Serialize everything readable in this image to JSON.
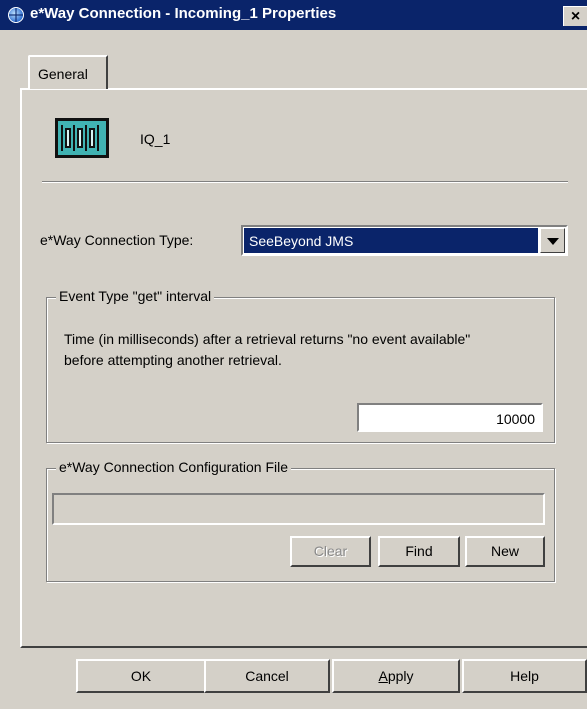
{
  "window": {
    "title": "e*Way Connection - Incoming_1 Properties",
    "close_glyph": "×",
    "icon": "globe-icon"
  },
  "tabs": [
    {
      "label": "General",
      "selected": true
    }
  ],
  "component": {
    "icon": "queue-component-icon",
    "name": "IQ_1"
  },
  "connection_type": {
    "label": "e*Way Connection Type:",
    "selected_value": "SeeBeyond JMS"
  },
  "interval_group": {
    "title": "Event Type \"get\" interval",
    "description": "Time (in milliseconds) after a retrieval returns \"no event available\" before attempting another retrieval.",
    "value": "10000"
  },
  "config_group": {
    "title": "e*Way Connection Configuration File",
    "file_value": "",
    "buttons": {
      "clear": "Clear",
      "find": "Find",
      "new": "New"
    }
  },
  "footer_buttons": {
    "ok": "OK",
    "cancel": "Cancel",
    "apply": "Apply",
    "help": "Help"
  },
  "colors": {
    "titlebar": "#0a246a",
    "dialog_face": "#d4d0c8",
    "selection": "#0a246a",
    "icon_teal": "#41b3b3"
  }
}
